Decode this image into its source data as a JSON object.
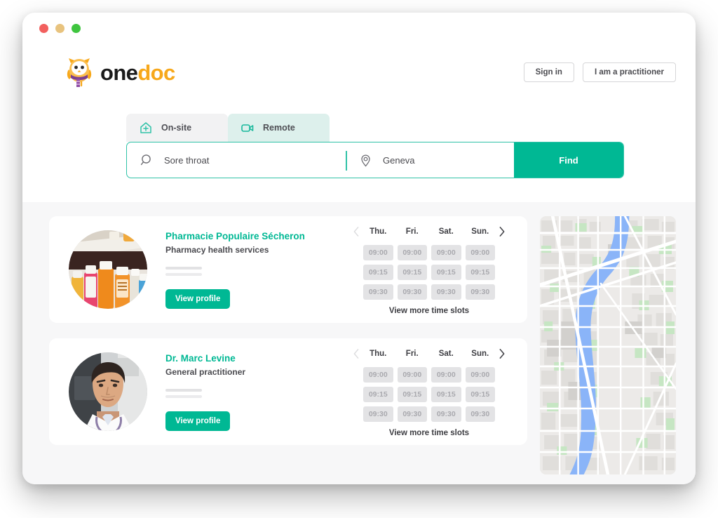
{
  "window": {
    "traffic_lights": [
      {
        "name": "close",
        "color": "#F2605E"
      },
      {
        "name": "minimize",
        "color": "#E8C37E"
      },
      {
        "name": "maximize",
        "color": "#3FC53F"
      }
    ]
  },
  "header": {
    "logo": {
      "text_one": "one",
      "text_doc": "doc",
      "mascot": "owl-mascot-icon",
      "brand_orange": "#F7A81B",
      "brand_dark": "#1b1b1b"
    },
    "actions": [
      {
        "name": "sign-in-button",
        "label": "Sign in"
      },
      {
        "name": "practitioner-button",
        "label": "I am a practitioner"
      }
    ]
  },
  "search": {
    "tabs": [
      {
        "name": "tab-onsite",
        "label": "On-site",
        "icon": "house-plus-icon",
        "active": false
      },
      {
        "name": "tab-remote",
        "label": "Remote",
        "icon": "video-camera-icon",
        "active": true
      }
    ],
    "query": {
      "icon": "search-icon",
      "value": "Sore throat",
      "placeholder": "Sore throat"
    },
    "location": {
      "icon": "map-pin-icon",
      "value": "Geneva",
      "placeholder": "Geneva"
    },
    "submit_label": "Find",
    "accent": "#00b894",
    "border": "#2fc2a7"
  },
  "results": {
    "prev_label": "chevron-left-icon",
    "next_label": "chevron-right-icon",
    "more_slots_label": "View more time slots",
    "view_profile_label": "View profile",
    "days": [
      "Thu.",
      "Fri.",
      "Sat.",
      "Sun."
    ],
    "cards": [
      {
        "name": "Pharmacie Populaire Sécheron",
        "subtitle": "Pharmacy health services",
        "avatar": "pharmacy-bottles-photo",
        "slot_rows": [
          [
            "09:00",
            "09:00",
            "09:00",
            "09:00"
          ],
          [
            "09:15",
            "09:15",
            "09:15",
            "09:15"
          ],
          [
            "09:30",
            "09:30",
            "09:30",
            "09:30"
          ]
        ]
      },
      {
        "name": "Dr. Marc Levine",
        "subtitle": "General practitioner",
        "avatar": "doctor-portrait-photo",
        "slot_rows": [
          [
            "09:00",
            "09:00",
            "09:00",
            "09:00"
          ],
          [
            "09:15",
            "09:15",
            "09:15",
            "09:15"
          ],
          [
            "09:30",
            "09:30",
            "09:30",
            "09:30"
          ]
        ]
      }
    ]
  },
  "map": {
    "name": "results-map",
    "land_color": "#eceae8",
    "water_color": "#8ab4f8",
    "park_color": "#c6e6c3",
    "road_color": "#ffffff"
  }
}
